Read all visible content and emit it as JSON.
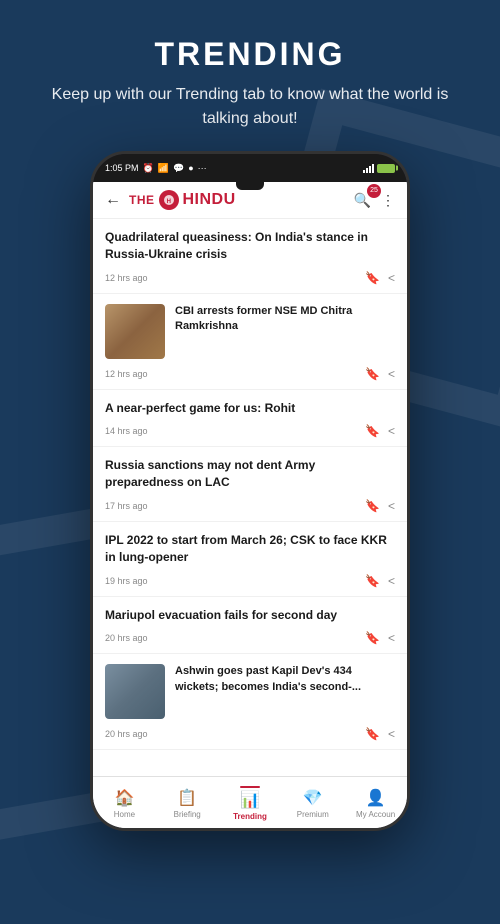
{
  "page": {
    "background_color": "#1a3a5c",
    "title": "TRENDING",
    "subtitle": "Keep up with our Trending tab to know what the world is talking about!"
  },
  "phone": {
    "status_bar": {
      "time": "1:05 PM",
      "battery_level": "charged"
    },
    "app_name": "THE HINDU",
    "notification_count": "25"
  },
  "news_items": [
    {
      "id": 1,
      "title": "Quadrilateral queasiness: On India's stance in Russia-Ukraine crisis",
      "time": "12 hrs ago",
      "has_image": false,
      "image_alt": null
    },
    {
      "id": 2,
      "title": "CBI arrests former NSE MD Chitra Ramkrishna",
      "time": "12 hrs ago",
      "has_image": true,
      "image_alt": "Chitra Ramkrishna photo"
    },
    {
      "id": 3,
      "title": "A near-perfect game for us: Rohit",
      "time": "14 hrs ago",
      "has_image": false,
      "image_alt": null
    },
    {
      "id": 4,
      "title": "Russia sanctions may not dent Army preparedness on LAC",
      "time": "17 hrs ago",
      "has_image": false,
      "image_alt": null
    },
    {
      "id": 5,
      "title": "IPL 2022 to start from March 26; CSK to face KKR in lung-opener",
      "time": "19 hrs ago",
      "has_image": false,
      "image_alt": null
    },
    {
      "id": 6,
      "title": "Mariupol evacuation fails for second day",
      "time": "20 hrs ago",
      "has_image": false,
      "image_alt": null
    },
    {
      "id": 7,
      "title": "Ashwin goes past Kapil Dev's 434 wickets; becomes India's second-...",
      "time": "20 hrs ago",
      "has_image": true,
      "image_alt": "Ashwin cricket photo"
    }
  ],
  "bottom_nav": {
    "items": [
      {
        "id": "home",
        "label": "Home",
        "icon": "🏠",
        "active": false
      },
      {
        "id": "briefing",
        "label": "Briefing",
        "icon": "📋",
        "active": false
      },
      {
        "id": "trending",
        "label": "Trending",
        "icon": "📊",
        "active": true
      },
      {
        "id": "premium",
        "label": "Premium",
        "icon": "💎",
        "active": false
      },
      {
        "id": "account",
        "label": "My Accoun",
        "icon": "👤",
        "active": false
      }
    ]
  }
}
